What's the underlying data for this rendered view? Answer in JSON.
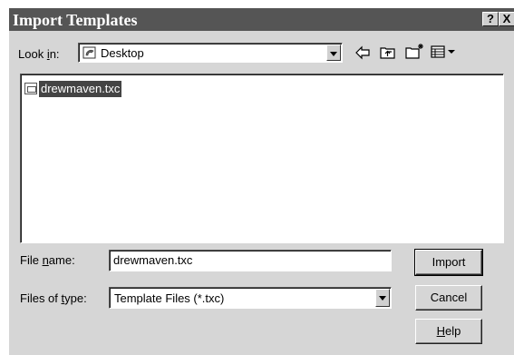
{
  "window": {
    "title": "Import Templates",
    "help_button": "?",
    "close_button": "X"
  },
  "lookin": {
    "label_prefix": "Look ",
    "label_accel": "i",
    "label_suffix": "n:",
    "value": "Desktop"
  },
  "files": [
    {
      "name": "drewmaven.txc"
    }
  ],
  "filename": {
    "label_prefix": "File ",
    "label_accel": "n",
    "label_suffix": "ame:",
    "value": "drewmaven.txc"
  },
  "filetype": {
    "label_prefix": "Files of ",
    "label_accel": "t",
    "label_suffix": "ype:",
    "value": "Template Files (*.txc)"
  },
  "buttons": {
    "import": "Import",
    "cancel": "Cancel",
    "help_accel": "H",
    "help_rest": "elp"
  },
  "toolbar": {
    "icons": [
      "back-arrow-icon",
      "up-folder-icon",
      "new-folder-icon",
      "view-menu-icon"
    ]
  }
}
